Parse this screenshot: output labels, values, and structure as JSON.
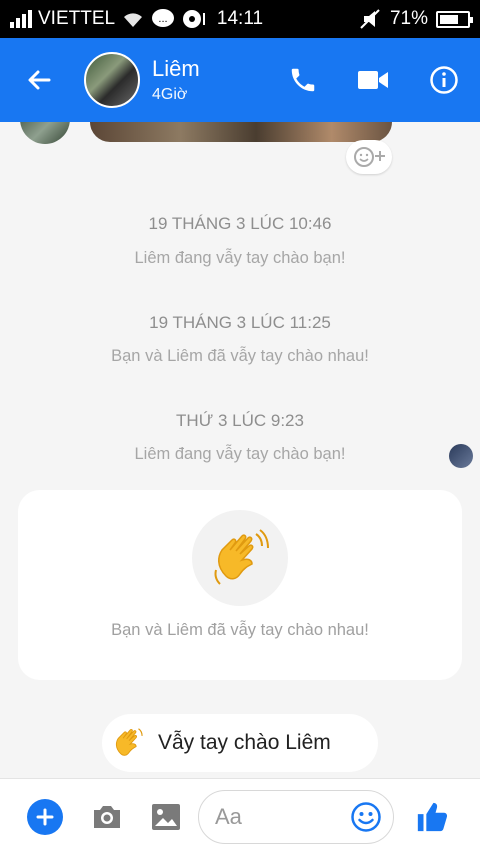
{
  "status_bar": {
    "carrier": "VIETTEL",
    "time": "14:11",
    "battery": "71%"
  },
  "header": {
    "name": "Liêm",
    "status": "4Giờ"
  },
  "chat": {
    "messages": [
      {
        "timestamp": "19 THÁNG 3 LÚC 10:46",
        "text": "Liêm đang vẫy tay chào bạn!"
      },
      {
        "timestamp": "19 THÁNG 3 LÚC 11:25",
        "text": "Bạn và Liêm đã vẫy tay chào nhau!"
      },
      {
        "timestamp": "THỨ 3 LÚC 9:23",
        "text": "Liêm đang vẫy tay chào bạn!"
      }
    ],
    "wave_card_text": "Bạn và Liêm đã vẫy tay chào nhau!",
    "wave_chip_label": "Vẫy tay chào Liêm"
  },
  "composer": {
    "placeholder": "Aa"
  },
  "colors": {
    "brand": "#1877f2",
    "wave": "#f7b928"
  },
  "icons": [
    "signal-icon",
    "wifi-icon",
    "chat-bubble-icon",
    "mute-icon",
    "battery-icon",
    "back-arrow-icon",
    "phone-icon",
    "video-camera-icon",
    "info-icon",
    "add-reaction-icon",
    "waving-hand-icon",
    "plus-icon",
    "camera-icon",
    "image-icon",
    "smiley-icon",
    "thumbs-up-icon"
  ]
}
